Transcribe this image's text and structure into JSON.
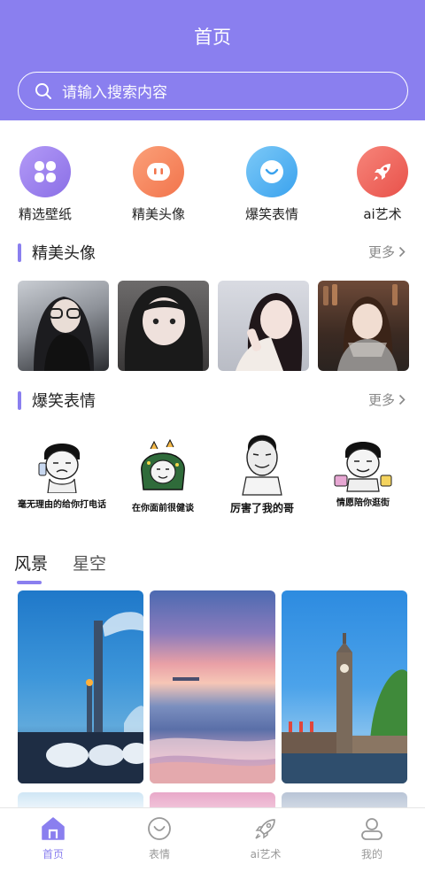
{
  "header": {
    "title": "首页"
  },
  "search": {
    "placeholder": "请输入搜索内容",
    "icon": "search-icon"
  },
  "categories": [
    {
      "label": "精选壁纸",
      "icon": "clover-icon",
      "color": "#9b83ee"
    },
    {
      "label": "精美头像",
      "icon": "chat-bubble-icon",
      "color": "#f6885e"
    },
    {
      "label": "爆笑表情",
      "icon": "smile-icon",
      "color": "#56b6f2"
    },
    {
      "label": "ai艺术",
      "icon": "rocket-icon",
      "color": "#f0655a"
    }
  ],
  "sections": {
    "avatars": {
      "title": "精美头像",
      "more": "更多"
    },
    "memes": {
      "title": "爆笑表情",
      "more": "更多"
    }
  },
  "memes": [
    {
      "caption": "毫无理由的给你打电话"
    },
    {
      "caption": "在你面前很健谈"
    },
    {
      "caption": "厉害了我的哥"
    },
    {
      "caption": "情愿陪你逛街"
    }
  ],
  "tabs": [
    {
      "label": "风景",
      "active": true
    },
    {
      "label": "星空",
      "active": false
    }
  ],
  "nav": [
    {
      "label": "首页",
      "icon": "home-icon",
      "active": true
    },
    {
      "label": "表情",
      "icon": "smile-icon",
      "active": false
    },
    {
      "label": "ai艺术",
      "icon": "rocket-icon",
      "active": false
    },
    {
      "label": "我的",
      "icon": "user-icon",
      "active": false
    }
  ],
  "colors": {
    "accent": "#8a7fef",
    "inactive": "#999999"
  }
}
